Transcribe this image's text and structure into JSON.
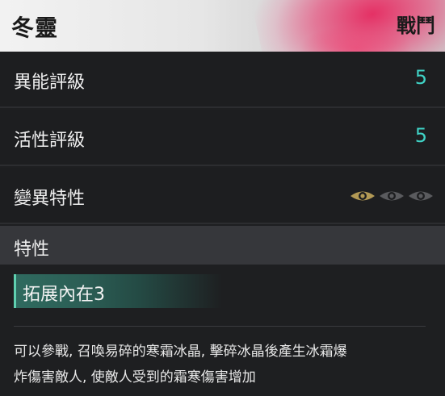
{
  "header": {
    "name": "冬靈",
    "tag": "戰鬥"
  },
  "stats": [
    {
      "label": "異能評級",
      "value": "5"
    },
    {
      "label": "活性評級",
      "value": "5"
    }
  ],
  "mutation": {
    "label": "變異特性",
    "eyes_total": 3,
    "eyes_active": 1
  },
  "traits_section": {
    "label": "特性"
  },
  "trait": {
    "name": "拓展內在3"
  },
  "description": {
    "line1": "可以參戰, 召喚易碎的寒霜冰晶, 擊碎冰晶後產生冰霜爆",
    "line2": "炸傷害敵人, 使敵人受到的霜寒傷害增加"
  },
  "colors": {
    "accent_teal": "#3fd3c6",
    "eye_active": "#b39a55",
    "eye_inactive": "#5a5b5e",
    "trait_green": "#2f6a5f"
  }
}
